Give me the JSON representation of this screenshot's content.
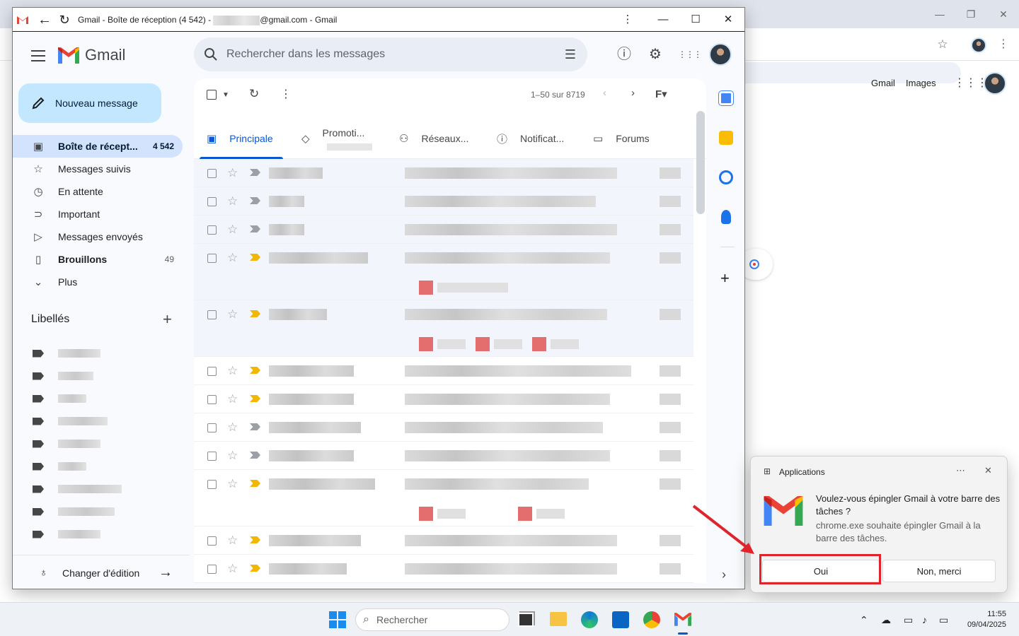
{
  "window": {
    "title_prefix": "Gmail - Boîte de réception (4 542) - ",
    "title_suffix": "@gmail.com - Gmail"
  },
  "browser_bg": {
    "links": [
      "Gmail",
      "Images"
    ]
  },
  "app": {
    "logo": "Gmail",
    "compose_label": "Nouveau message",
    "search_placeholder": "Rechercher dans les messages"
  },
  "nav": {
    "items": [
      {
        "label": "Boîte de récept...",
        "count": "4 542",
        "icon": "inbox-icon"
      },
      {
        "label": "Messages suivis",
        "count": "",
        "icon": "star-icon"
      },
      {
        "label": "En attente",
        "count": "",
        "icon": "clock-icon"
      },
      {
        "label": "Important",
        "count": "",
        "icon": "important-icon"
      },
      {
        "label": "Messages envoyés",
        "count": "",
        "icon": "send-icon"
      },
      {
        "label": "Brouillons",
        "count": "49",
        "icon": "draft-icon"
      },
      {
        "label": "Plus",
        "count": "",
        "icon": "chevron-down-icon"
      }
    ],
    "labels_heading": "Libellés",
    "change_edition": "Changer d'édition"
  },
  "toolbar": {
    "pagination": "1–50 sur 8719"
  },
  "tabs": [
    {
      "label": "Principale",
      "icon": "inbox-icon",
      "active": true
    },
    {
      "label": "Promoti...",
      "icon": "tag-icon",
      "active": false
    },
    {
      "label": "Réseaux...",
      "icon": "people-icon",
      "active": false
    },
    {
      "label": "Notificat...",
      "icon": "info-icon",
      "active": false
    },
    {
      "label": "Forums",
      "icon": "forum-icon",
      "active": false
    }
  ],
  "emails": [
    {
      "important": false,
      "height": 40,
      "attachments": 0
    },
    {
      "important": false,
      "height": 40,
      "attachments": 0
    },
    {
      "important": false,
      "height": 40,
      "attachments": 0
    },
    {
      "important": true,
      "height": 80,
      "attachments": 1
    },
    {
      "important": true,
      "height": 80,
      "attachments": 3
    },
    {
      "important": true,
      "height": 40,
      "attachments": 0
    },
    {
      "important": true,
      "height": 40,
      "attachments": 0
    },
    {
      "important": false,
      "height": 40,
      "attachments": 0
    },
    {
      "important": false,
      "height": 40,
      "attachments": 0
    },
    {
      "important": true,
      "height": 80,
      "attachments": 2
    },
    {
      "important": true,
      "height": 40,
      "attachments": 0
    },
    {
      "important": true,
      "height": 40,
      "attachments": 0
    }
  ],
  "toast": {
    "app_name": "Applications",
    "title": "Voulez-vous épingler Gmail à votre barre des tâches ?",
    "body": "chrome.exe souhaite épingler Gmail à la barre des tâches.",
    "yes_label": "Oui",
    "no_label": "Non, merci"
  },
  "taskbar": {
    "search_placeholder": "Rechercher",
    "time": "11:55",
    "date": "09/04/2025"
  },
  "colors": {
    "accent": "#0b57d0",
    "compose_bg": "#c2e7ff",
    "nav_active_bg": "#d3e3fd",
    "highlight": "#e0242b",
    "important": "#f2b705"
  }
}
